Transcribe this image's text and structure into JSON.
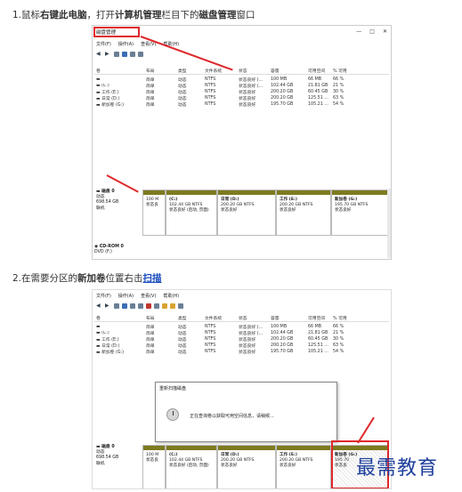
{
  "step1": {
    "prefix": "1.鼠标",
    "b1": "右键此电脑",
    "mid": "，打开",
    "b2": "计算机管理",
    "mid2": "栏目下的",
    "b3": "磁盘管理",
    "suffix": "窗口"
  },
  "step2": {
    "prefix": "2.在需要分区的",
    "b1": "新加卷",
    "mid": "位置右击",
    "link": "扫描"
  },
  "window": {
    "title": "磁盘管理",
    "menu": [
      "文件(F)",
      "操作(A)",
      "查看(V)",
      "帮助(H)"
    ],
    "controls": [
      "—",
      "□",
      "✕"
    ],
    "columns": [
      "卷",
      "布局",
      "类型",
      "文件系统",
      "状态",
      "容量",
      "可用空间",
      "% 可用"
    ],
    "volumes": [
      [
        "",
        "简单",
        "动态",
        "NTFS",
        "状态良好 (...",
        "100 MB",
        "66 MB",
        "66 %"
      ],
      [
        "(C:)",
        "简单",
        "动态",
        "NTFS",
        "状态良好 (...",
        "102.44 GB",
        "21.81 GB",
        "21 %"
      ],
      [
        "工作 (E:)",
        "简单",
        "动态",
        "NTFS",
        "状态良好",
        "200.20 GB",
        "60.45 GB",
        "30 %"
      ],
      [
        "日常 (D:)",
        "简单",
        "动态",
        "NTFS",
        "状态良好",
        "200.20 GB",
        "125.51 ...",
        "63 %"
      ],
      [
        "新加卷 (G:)",
        "简单",
        "动态",
        "NTFS",
        "状态良好",
        "195.70 GB",
        "105.21 ...",
        "54 %"
      ]
    ],
    "disk0": {
      "name": "磁盘 0",
      "type": "动态",
      "size": "698.54 GB",
      "status": "联机",
      "partitions": [
        {
          "name": "",
          "size": "100 M",
          "status": "状态良"
        },
        {
          "name": "(C:)",
          "size": "102.44 GB NTFS",
          "status": "状态良好 (启动, 页面)"
        },
        {
          "name": "日常 (D:)",
          "size": "200.20 GB NTFS",
          "status": "状态良好"
        },
        {
          "name": "工作 (E:)",
          "size": "200.20 GB NTFS",
          "status": "状态良好"
        },
        {
          "name": "新加卷 (G:)",
          "size": "195.70 GB NTFS",
          "status": "状态良好"
        }
      ]
    },
    "cdrom": {
      "name": "CD-ROM 0",
      "type": "DVD (F:)"
    }
  },
  "window2": {
    "menu": [
      "文件(F)",
      "操作(A)",
      "查看(V)",
      "帮助(H)"
    ],
    "disk0": {
      "name": "磁盘 0",
      "type": "动态",
      "size": "698.54 GB",
      "status": "联机",
      "partitions": [
        {
          "name": "",
          "size": "100 M",
          "status": "状态良"
        },
        {
          "name": "(C:)",
          "size": "102.44 GB NTFS",
          "status": "状态良好 (启动, 页面)"
        },
        {
          "name": "日常 (D:)",
          "size": "200.20 GB NTFS",
          "status": "状态良好"
        },
        {
          "name": "工作 (E:)",
          "size": "200.20 GB NTFS",
          "status": "状态良好"
        },
        {
          "name": "新加卷 (G:)",
          "size": "195.70",
          "status": "状态良"
        }
      ]
    }
  },
  "dialog": {
    "title": "重新扫描磁盘",
    "message": "正在查询卷以获取可用空间信息，请稍候..."
  },
  "watermark": "最需教育",
  "colors": {
    "highlight": "#e0282c",
    "partitionBar": "#7d7a1f",
    "link": "#1a4dbf",
    "watermark": "#1e3f9c"
  }
}
